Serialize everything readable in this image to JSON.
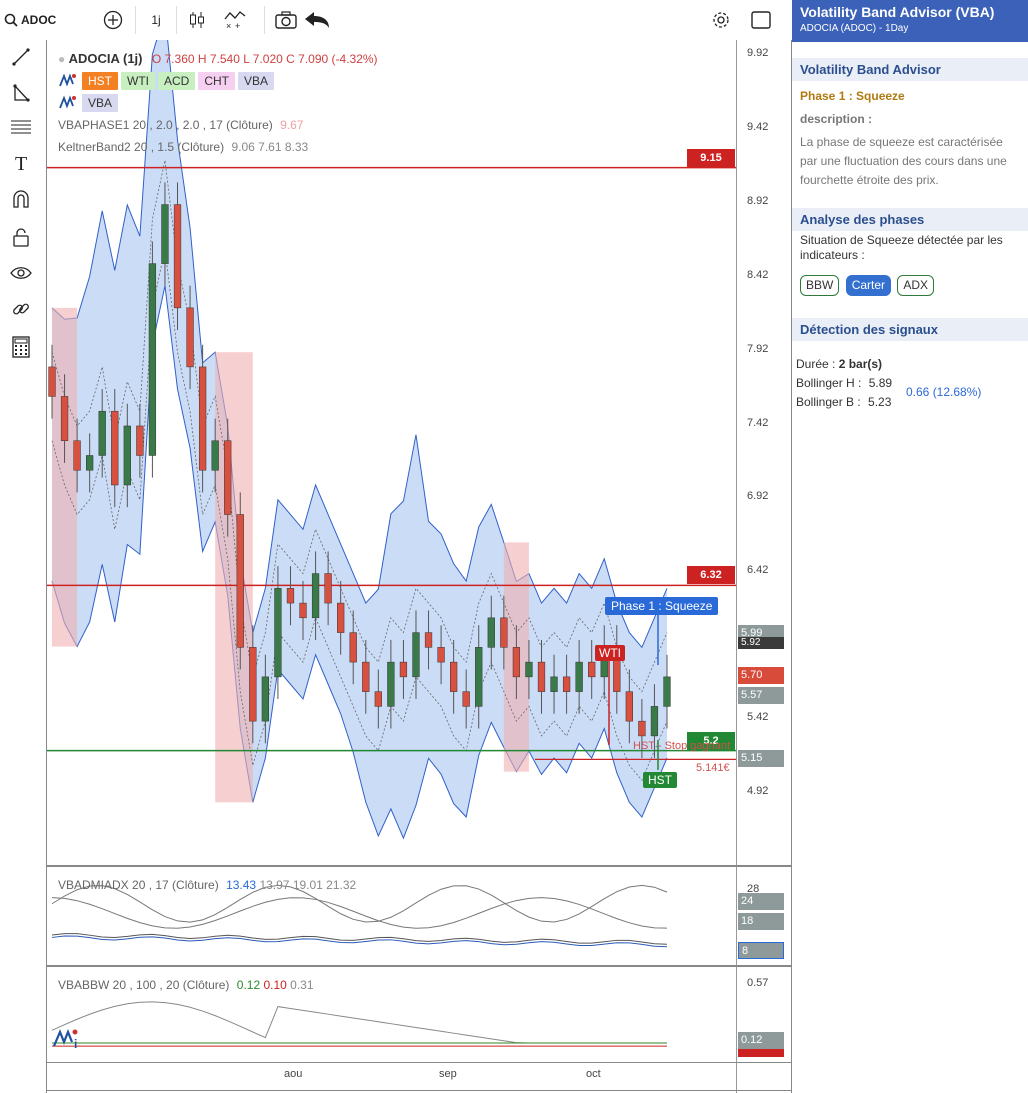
{
  "toolbar": {
    "symbol": "ADOC",
    "interval": "1j"
  },
  "legend": {
    "symbol_name": "ADOCIA (1j)",
    "ohlc": "O 7.360 H 7.540 L 7.020 C 7.090 (-4.32%)",
    "buttons": [
      {
        "label": "HST",
        "bg": "#f48024",
        "color": "#fff"
      },
      {
        "label": "WTI",
        "bg": "#c8efc0",
        "color": "#333"
      },
      {
        "label": "ACD",
        "bg": "#c8efc0",
        "color": "#333"
      },
      {
        "label": "CHT",
        "bg": "#f6d0f0",
        "color": "#333"
      },
      {
        "label": "VBA",
        "bg": "#d8d8f0",
        "color": "#333"
      }
    ],
    "vba_label": "VBA",
    "vbaphase": "VBAPHASE1 20 , 2.0 , 2.0 , 17 (Clôture)",
    "vbaphase_val": "9.67",
    "keltner": "KeltnerBand2 20 , 1.5 (Clôture)",
    "keltner_vals": "9.06 7.61 8.33",
    "adx": "VBADMIADX 20 , 17 (Clôture)",
    "adx_val1": "13.43",
    "adx_vals": "13.97 19.01 21.32",
    "bbw": "VBABBW 20 , 100 , 20 (Clôture)",
    "bbw_v1": "0.12",
    "bbw_v2": "0.10",
    "bbw_v3": "0.31"
  },
  "price_axis": [
    "9.92",
    "9.42",
    "8.92",
    "8.42",
    "7.92",
    "7.42",
    "6.92",
    "6.42",
    "5.42",
    "4.92"
  ],
  "levels": {
    "red_top": "9.15",
    "red_mid": "6.32",
    "green": "5.2"
  },
  "axis_boxes": {
    "v599": "5.99",
    "v592": "5.92",
    "v570": "5.70",
    "v557": "5.57",
    "v515": "5.15"
  },
  "annotations": {
    "phase": "Phase 1 : Squeeze",
    "wti": "WTI",
    "hst": "HST",
    "hst_stop": "HST - Stop gagnant",
    "stop_price": "5.141€"
  },
  "adx_axis": {
    "v28": "28",
    "v24": "24",
    "v18": "18",
    "v8": "8"
  },
  "bbw_axis": {
    "v057": "0.57",
    "v012": "0.12"
  },
  "x_axis": [
    "aou",
    "sep",
    "oct"
  ],
  "chart_data": {
    "type": "candlestick",
    "title": "ADOCIA (1j)",
    "ylim": [
      4.9,
      10.0
    ],
    "ohlc_last": {
      "open": 7.36,
      "high": 7.54,
      "low": 7.02,
      "close": 7.09,
      "change_pct": -4.32
    },
    "horizontal_levels": [
      9.15,
      6.32,
      5.2
    ],
    "series_close_approx": [
      7.6,
      7.3,
      7.1,
      7.2,
      7.5,
      7.0,
      7.4,
      7.2,
      8.5,
      8.9,
      8.2,
      7.8,
      7.1,
      7.3,
      6.8,
      5.9,
      5.4,
      5.7,
      6.3,
      6.2,
      6.1,
      6.4,
      6.2,
      6.0,
      5.8,
      5.6,
      5.5,
      5.8,
      5.7,
      6.0,
      5.9,
      5.8,
      5.6,
      5.5,
      5.9,
      6.1,
      5.9,
      5.7,
      5.8,
      5.6,
      5.7,
      5.6,
      5.8,
      5.7,
      5.9,
      5.6,
      5.4,
      5.3,
      5.5,
      5.7
    ]
  },
  "side": {
    "title": "Volatility Band Advisor (VBA)",
    "subtitle": "ADOCIA (ADOC) - 1Day",
    "s1_title": "Volatility Band Advisor",
    "phase_label": "Phase 1 : Squeeze",
    "desc_label": "description :",
    "desc_text": "La phase de squeeze est caractérisée par une fluctuation des cours dans une fourchette étroite des prix.",
    "s2_title": "Analyse des phases",
    "s2_text": "Situation de Squeeze détectée par les indicateurs :",
    "tags": [
      "BBW",
      "Carter",
      "ADX"
    ],
    "s3_title": "Détection des signaux",
    "duree_label": "Durée :",
    "duree_val": "2 bar(s)",
    "boll_h_label": "Bollinger H :",
    "boll_h_val": "5.89",
    "boll_b_label": "Bollinger B :",
    "boll_b_val": "5.23",
    "boll_diff": "0.66 (12.68%)"
  }
}
